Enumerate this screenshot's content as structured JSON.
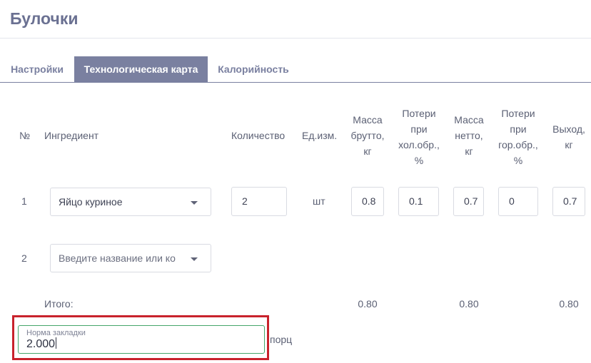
{
  "title": "Булочки",
  "tabs": [
    {
      "label": "Настройки",
      "active": false
    },
    {
      "label": "Технологическая карта",
      "active": true
    },
    {
      "label": "Калорийность",
      "active": false
    }
  ],
  "table": {
    "headers": {
      "num": "№",
      "ingredient": "Ингредиент",
      "quantity": "Количество",
      "unit": "Ед.изм.",
      "gross_l1": "Масса",
      "gross_l2": "брутто,",
      "gross_l3": "кг",
      "cold_l1": "Потери",
      "cold_l2": "при",
      "cold_l3": "хол.обр.,",
      "cold_l4": "%",
      "net_l1": "Масса",
      "net_l2": "нетто,",
      "net_l3": "кг",
      "hot_l1": "Потери",
      "hot_l2": "при",
      "hot_l3": "гор.обр.,",
      "hot_l4": "%",
      "yield_l1": "Выход,",
      "yield_l2": "кг"
    },
    "rows": [
      {
        "num": "1",
        "ingredient": "Яйцо куриное",
        "quantity": "2",
        "unit": "шт",
        "gross": "0.8",
        "cold_loss": "0.1",
        "net": "0.7",
        "hot_loss": "0",
        "yield": "0.7"
      },
      {
        "num": "2",
        "ingredient_placeholder": "Введите название или ко"
      }
    ],
    "totals": {
      "label": "Итого:",
      "gross": "0.80",
      "net": "0.80",
      "yield": "0.80"
    }
  },
  "norm": {
    "label": "Норма закладки",
    "value": "2.000",
    "unit": "порц"
  },
  "colors": {
    "accent": "#7a80a0",
    "highlight": "#c8222c",
    "focus": "#45a66a"
  }
}
